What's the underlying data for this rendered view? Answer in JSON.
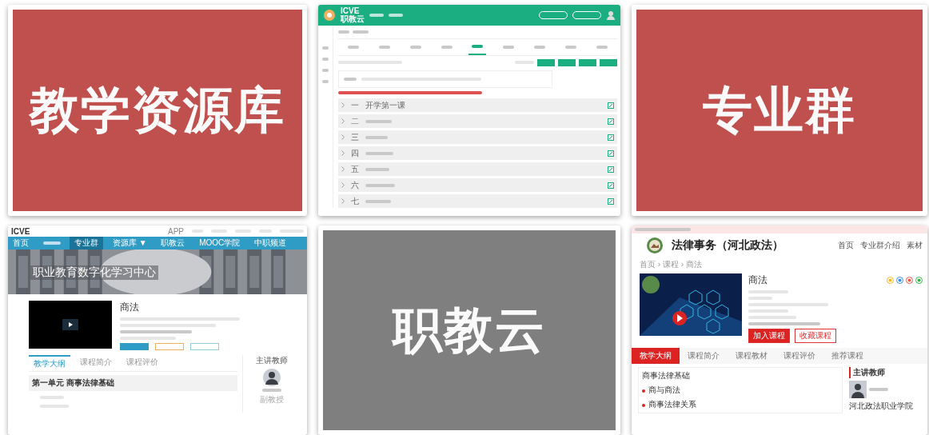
{
  "cards": [
    {
      "kind": "title",
      "label": "教学资源库",
      "color": "#c0504d"
    },
    {
      "kind": "course_design",
      "logo": "ICVE",
      "logo_sub": "职教云",
      "tabs": [
        {
          "selected": false
        },
        {
          "selected": false
        },
        {
          "selected": false
        },
        {
          "selected": false
        },
        {
          "selected": true
        },
        {
          "selected": false
        },
        {
          "selected": false
        },
        {
          "selected": false
        },
        {
          "selected": false
        }
      ],
      "rows": [
        {
          "number": "一",
          "title": "开学第一课"
        },
        {
          "number": "二"
        },
        {
          "number": "三"
        },
        {
          "number": "四"
        },
        {
          "number": "五"
        },
        {
          "number": "六"
        },
        {
          "number": "七"
        }
      ]
    },
    {
      "kind": "title",
      "label": "专业群",
      "color": "#c0504d"
    },
    {
      "kind": "course_portal",
      "logo": "ICVE",
      "app": "APP",
      "nav": [
        {
          "label": "首页",
          "selected": false
        },
        {
          "selected": false
        },
        {
          "label": "专业群",
          "selected": true
        },
        {
          "label": "资源库 ▼",
          "selected": false
        },
        {
          "label": "职教云",
          "selected": false
        },
        {
          "label": "MOOC学院",
          "selected": false
        },
        {
          "label": "中职频道",
          "selected": false
        }
      ],
      "banner": "职业教育数字化学习中心",
      "course_title": "商法",
      "tabs": [
        {
          "label": "教学大纲",
          "selected": true
        },
        {
          "label": "课程简介",
          "selected": false
        },
        {
          "label": "课程评价",
          "selected": false
        }
      ],
      "unit": "第一单元 商事法律基础",
      "teacher_heading": "主讲教师",
      "teacher_title": "副教授"
    },
    {
      "kind": "title",
      "label": "职教云",
      "color": "#7f7f7f"
    },
    {
      "kind": "major_portal",
      "name": "法律事务（河北政法）",
      "nav": [
        "首页",
        "专业群介绍",
        "素材"
      ],
      "breadcrumb": "首页 › 课程 › 商法",
      "course_title": "商法",
      "join": "加入课程",
      "favorite": "收藏课程",
      "tabs": [
        {
          "label": "教学大纲",
          "selected": true
        },
        {
          "label": "课程简介",
          "selected": false
        },
        {
          "label": "课程教材",
          "selected": false
        },
        {
          "label": "课程评价",
          "selected": false
        },
        {
          "label": "推荐课程",
          "selected": false
        }
      ],
      "section": "商事法律基础",
      "lessons": [
        "商与商法",
        "商事法律关系"
      ],
      "teacher_heading": "主讲教师",
      "school": "河北政法职业学院"
    }
  ]
}
